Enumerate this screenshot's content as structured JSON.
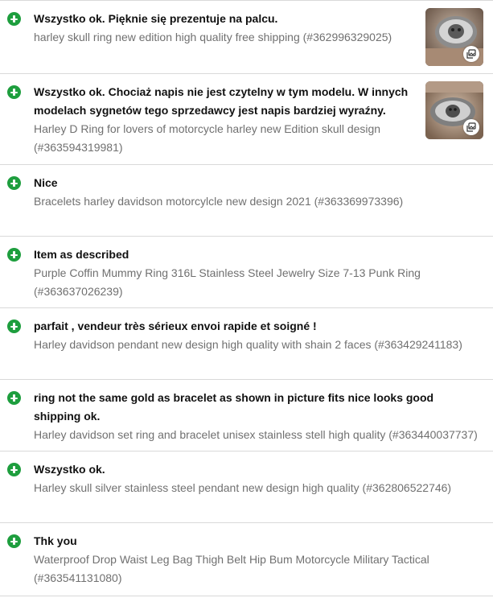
{
  "feedback": [
    {
      "comment": "Wszystko ok. Pięknie się prezentuje na palcu.",
      "item": "harley skull ring new edition high quality free shipping (#362996329025)",
      "has_photo": true
    },
    {
      "comment": "Wszystko ok. Chociaż napis nie jest czytelny w tym modelu. W innych modelach sygnetów tego sprzedawcy jest napis bardziej wyraźny.",
      "item": "Harley D Ring for lovers of motorcycle harley new Edition skull design (#363594319981)",
      "has_photo": true
    },
    {
      "comment": "Nice",
      "item": "Bracelets harley davidson motorcylcle new design 2021 (#363369973396)",
      "has_photo": false
    },
    {
      "comment": "Item as described",
      "item": "Purple Coffin Mummy Ring 316L Stainless Steel Jewelry Size 7-13 Punk Ring (#363637026239)",
      "has_photo": false
    },
    {
      "comment": "parfait , vendeur très sérieux envoi rapide et soigné !",
      "item": "Harley davidson pendant new design high quality with shain 2 faces (#363429241183)",
      "has_photo": false
    },
    {
      "comment": "ring not the same gold as bracelet as shown in picture fits nice looks good shipping ok.",
      "item": "Harley davidson set ring and bracelet unisex stainless stell high quality (#363440037737)",
      "has_photo": false
    },
    {
      "comment": "Wszystko ok.",
      "item": "Harley skull silver stainless steel pendant new design high quality (#362806522746)",
      "has_photo": false
    },
    {
      "comment": "Thk you",
      "item": "Waterproof Drop Waist Leg Bag Thigh Belt Hip Bum Motorcycle Military Tactical (#363541131080)",
      "has_photo": false
    }
  ],
  "icons": {
    "rating": "positive-plus-icon",
    "photo_badge": "photo-gallery-icon"
  },
  "colors": {
    "positive": "#1e9e3e",
    "comment_text": "#111111",
    "item_text": "#707070",
    "divider": "#d9d9d9"
  }
}
